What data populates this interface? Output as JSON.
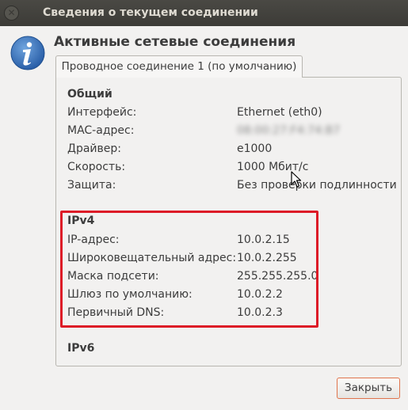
{
  "window": {
    "title": "Сведения о текущем соединении",
    "close_glyph": "✕"
  },
  "heading": "Активные сетевые соединения",
  "tab": {
    "label": "Проводное соединение 1 (по умолчанию)"
  },
  "general": {
    "title": "Общий",
    "rows": [
      {
        "label": "Интерфейс:",
        "value": "Ethernet (eth0)"
      },
      {
        "label": "MAC-адрес:",
        "value": "08:00:27:F4:74:B7"
      },
      {
        "label": "Драйвер:",
        "value": "e1000"
      },
      {
        "label": "Скорость:",
        "value": "1000 Мбит/с"
      },
      {
        "label": "Защита:",
        "value": "Без проверки подлинности"
      }
    ]
  },
  "ipv4": {
    "title": "IPv4",
    "rows": [
      {
        "label": "IP-адрес:",
        "value": "10.0.2.15"
      },
      {
        "label": "Широковещательный адрес:",
        "value": "10.0.2.255"
      },
      {
        "label": "Маска подсети:",
        "value": "255.255.255.0"
      },
      {
        "label": "Шлюз по умолчанию:",
        "value": "10.0.2.2"
      },
      {
        "label": "Первичный DNS:",
        "value": "10.0.2.3"
      }
    ]
  },
  "ipv6": {
    "title": "IPv6"
  },
  "buttons": {
    "close_label": "Закрыть"
  },
  "colors": {
    "highlight": "#dd1b27",
    "titlebar": "#3c3b37",
    "button_border": "#e0744c"
  },
  "icons": {
    "info": "info-icon",
    "cursor": "mouse-pointer-icon",
    "window_close": "close-icon"
  }
}
